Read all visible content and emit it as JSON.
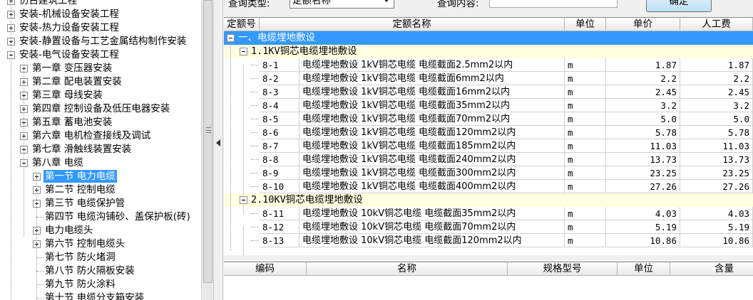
{
  "tree": {
    "items": [
      {
        "label": "仿古建筑工程",
        "level": 0,
        "icon": "plus"
      },
      {
        "label": "安装-机械设备安装工程",
        "level": 0,
        "icon": "plus"
      },
      {
        "label": "安装-热力设备安装工程",
        "level": 0,
        "icon": "plus"
      },
      {
        "label": "安装-静置设备与工艺金属结构制作安装",
        "level": 0,
        "icon": "plus"
      },
      {
        "label": "安装-电气设备安装工程",
        "level": 0,
        "icon": "minus"
      },
      {
        "label": "第一章  变压器安装",
        "level": 1,
        "icon": "plus"
      },
      {
        "label": "第二章  配电装置安装",
        "level": 1,
        "icon": "plus"
      },
      {
        "label": "第三章  母线安装",
        "level": 1,
        "icon": "plus"
      },
      {
        "label": "第四章  控制设备及低压电器安装",
        "level": 1,
        "icon": "plus"
      },
      {
        "label": "第五章  蓄电池安装",
        "level": 1,
        "icon": "plus"
      },
      {
        "label": "第六章  电机检查接线及调试",
        "level": 1,
        "icon": "plus"
      },
      {
        "label": "第七章  滑触线装置安装",
        "level": 1,
        "icon": "plus"
      },
      {
        "label": "第八章  电缆",
        "level": 1,
        "icon": "minus"
      },
      {
        "label": "第一节  电力电缆",
        "level": 2,
        "icon": "plus",
        "selected": true
      },
      {
        "label": "第二节  控制电缆",
        "level": 2,
        "icon": "plus"
      },
      {
        "label": "第三节  电缆保护管",
        "level": 2,
        "icon": "plus"
      },
      {
        "label": "第四节  电缆沟铺砂、盖保护板(砖)",
        "level": 2,
        "icon": "none"
      },
      {
        "label": "电力电缆头",
        "level": 2,
        "icon": "plus"
      },
      {
        "label": "第六节  控制电缆头",
        "level": 2,
        "icon": "plus"
      },
      {
        "label": "第七节  防火堵洞",
        "level": 2,
        "icon": "none"
      },
      {
        "label": "第八节  防火隔板安装",
        "level": 2,
        "icon": "none"
      },
      {
        "label": "第九节  防火涂料",
        "level": 2,
        "icon": "none"
      },
      {
        "label": "第十节  电缆分支箱安装",
        "level": 2,
        "icon": "none"
      }
    ]
  },
  "query": {
    "type_label": "查询类型:",
    "type_value": "定额名称",
    "content_label": "查询内容:",
    "content_value": "",
    "confirm_label": "确定"
  },
  "main_table": {
    "columns": [
      "定额号",
      "定额名称",
      "单位",
      "单价",
      "人工费"
    ],
    "group1": "一、电缆埋地敷设",
    "subgroup1": "1.1KV铜芯电缆埋地敷设",
    "subgroup2": "2.10KV铜芯电缆埋地敷设",
    "rows_a": [
      {
        "code": "8-1",
        "name": "电缆埋地敷设 1kV铜芯电缆 电缆截面2.5mm2以内",
        "unit": "m",
        "price": "1.87",
        "labor": "1.87"
      },
      {
        "code": "8-2",
        "name": "电缆埋地敷设 1kV铜芯电缆 电缆截面6mm2以内",
        "unit": "m",
        "price": "2.2",
        "labor": "2.2"
      },
      {
        "code": "8-3",
        "name": "电缆埋地敷设 1kV铜芯电缆 电缆截面16mm2以内",
        "unit": "m",
        "price": "2.45",
        "labor": "2.45"
      },
      {
        "code": "8-4",
        "name": "电缆埋地敷设 1kV铜芯电缆 电缆截面35mm2以内",
        "unit": "m",
        "price": "3.2",
        "labor": "3.2"
      },
      {
        "code": "8-5",
        "name": "电缆埋地敷设 1kV铜芯电缆 电缆截面70mm2以内",
        "unit": "m",
        "price": "5.0",
        "labor": "5.0"
      },
      {
        "code": "8-6",
        "name": "电缆埋地敷设 1kV铜芯电缆 电缆截面120mm2以内",
        "unit": "m",
        "price": "5.78",
        "labor": "5.78"
      },
      {
        "code": "8-7",
        "name": "电缆埋地敷设 1kV铜芯电缆 电缆截面185mm2以内",
        "unit": "m",
        "price": "11.03",
        "labor": "11.03"
      },
      {
        "code": "8-8",
        "name": "电缆埋地敷设 1kV铜芯电缆 电缆截面240mm2以内",
        "unit": "m",
        "price": "13.73",
        "labor": "13.73"
      },
      {
        "code": "8-9",
        "name": "电缆埋地敷设 1kV铜芯电缆 电缆截面300mm2以内",
        "unit": "m",
        "price": "23.25",
        "labor": "23.25"
      },
      {
        "code": "8-10",
        "name": "电缆埋地敷设 1kV铜芯电缆 电缆截面400mm2以内",
        "unit": "m",
        "price": "27.26",
        "labor": "27.26"
      }
    ],
    "rows_b": [
      {
        "code": "8-11",
        "name": "电缆埋地敷设 10kV铜芯电缆 电缆截面35mm2以内",
        "unit": "m",
        "price": "4.03",
        "labor": "4.03"
      },
      {
        "code": "8-12",
        "name": "电缆埋地敷设 10kV铜芯电缆 电缆截面70mm2以内",
        "unit": "m",
        "price": "5.19",
        "labor": "5.19"
      },
      {
        "code": "8-13",
        "name": "电缆埋地敷设 10kV铜芯电缆 电缆截面120mm2以内",
        "unit": "m",
        "price": "10.86",
        "labor": "10.86"
      }
    ]
  },
  "bottom_table": {
    "columns": [
      "编码",
      "名称",
      "规格型号",
      "单位",
      "含量"
    ]
  },
  "colors": {
    "selection": "#3399ff",
    "subgroup_bg": "#ffffe1"
  }
}
